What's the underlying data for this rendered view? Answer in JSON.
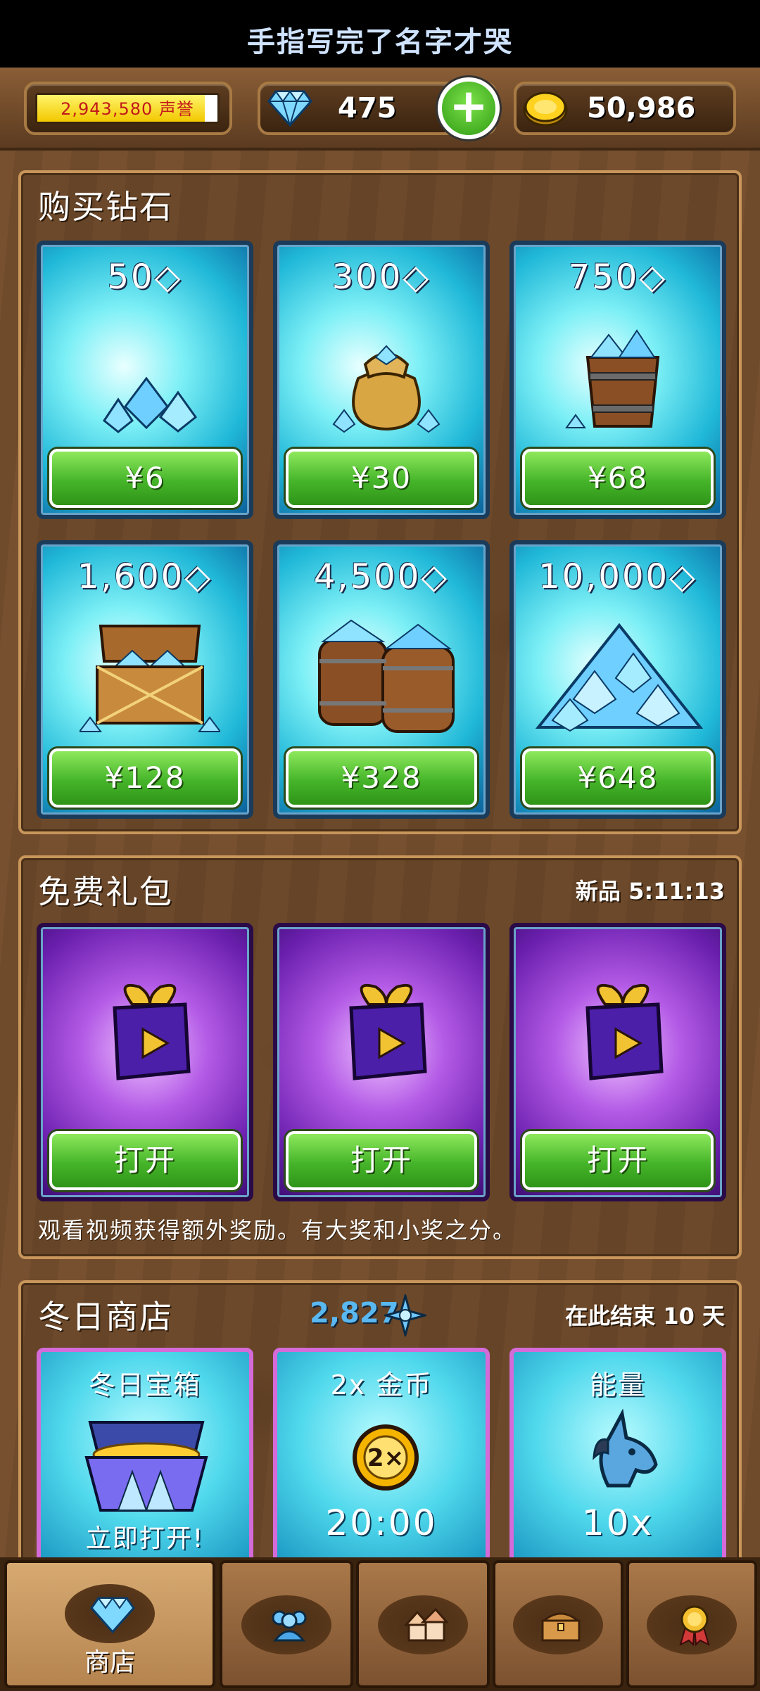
{
  "banner": {
    "text": "手指写完了名字才哭"
  },
  "topbar": {
    "reputation": {
      "text": "2,943,580 声誉",
      "progress": 0.93
    },
    "gems": {
      "count": "475",
      "icon": "diamond-icon"
    },
    "add_button": {
      "icon": "plus-icon"
    },
    "gold": {
      "count": "50,986",
      "icon": "gold-coin-icon"
    }
  },
  "buy_diamonds": {
    "title": "购买钻石",
    "packs": [
      {
        "amount": "50",
        "price": "¥6",
        "image": "small-gem-pile"
      },
      {
        "amount": "300",
        "price": "¥30",
        "image": "gem-sack"
      },
      {
        "amount": "750",
        "price": "¥68",
        "image": "gem-bucket"
      },
      {
        "amount": "1,600",
        "price": "¥128",
        "image": "gem-chest"
      },
      {
        "amount": "4,500",
        "price": "¥328",
        "image": "gem-barrels"
      },
      {
        "amount": "10,000",
        "price": "¥648",
        "image": "gem-mountain"
      }
    ]
  },
  "free_gifts": {
    "title": "免费礼包",
    "timer": "新品 5:11:13",
    "gifts": [
      {
        "button": "打开",
        "icon": "video-gift-box-icon"
      },
      {
        "button": "打开",
        "icon": "video-gift-box-icon"
      },
      {
        "button": "打开",
        "icon": "video-gift-box-icon"
      }
    ],
    "note": "观看视频获得额外奖励。有大奖和小奖之分。"
  },
  "winter_shop": {
    "title": "冬日商店",
    "currency": {
      "count": "2,827",
      "icon": "snowflake-star-icon"
    },
    "ends": "在此结束 10 天",
    "items": [
      {
        "label": "冬日宝箱",
        "sub": "立即打开!",
        "icon": "winter-chest-icon"
      },
      {
        "label": "2x 金币",
        "sub": "20:00",
        "icon": "double-coin-icon"
      },
      {
        "label": "能量",
        "sub": "10x",
        "icon": "unicorn-head-icon"
      }
    ]
  },
  "nav": {
    "tabs": [
      {
        "label": "商店",
        "icon": "diamond-icon",
        "active": true
      },
      {
        "label": "",
        "icon": "people-icon"
      },
      {
        "label": "",
        "icon": "buildings-icon"
      },
      {
        "label": "",
        "icon": "treasure-chest-icon"
      },
      {
        "label": "",
        "icon": "medal-icon"
      }
    ]
  },
  "colors": {
    "accent_green": "#46b52a",
    "gem_blue": "#20b8d8",
    "gift_purple": "#6a1fad",
    "wood": "#6e4a2b"
  }
}
